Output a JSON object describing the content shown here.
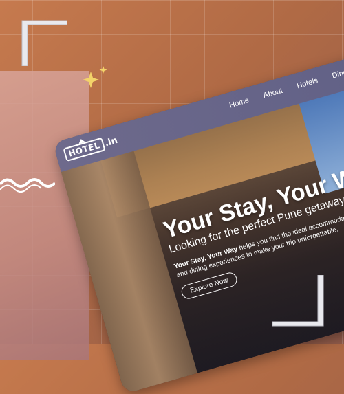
{
  "logo": {
    "box_text": "HOTEL",
    "suffix": ".in"
  },
  "nav": {
    "items": [
      "Home",
      "About",
      "Hotels",
      "Dine-in"
    ]
  },
  "hero": {
    "title": "Your Stay, Your Way",
    "subtitle": "Looking for the perfect Pune getaway??",
    "desc_bold": "Your Stay, Your Way",
    "desc_rest": " helps you find the ideal accommodation and dining experiences to make your trip unforgettable.",
    "cta": "Explore Now"
  },
  "colors": {
    "navbar": "#6e6a8c",
    "background": "#c67a4e",
    "panel": "#d9a59a",
    "sparkle": "#f3d36a"
  }
}
